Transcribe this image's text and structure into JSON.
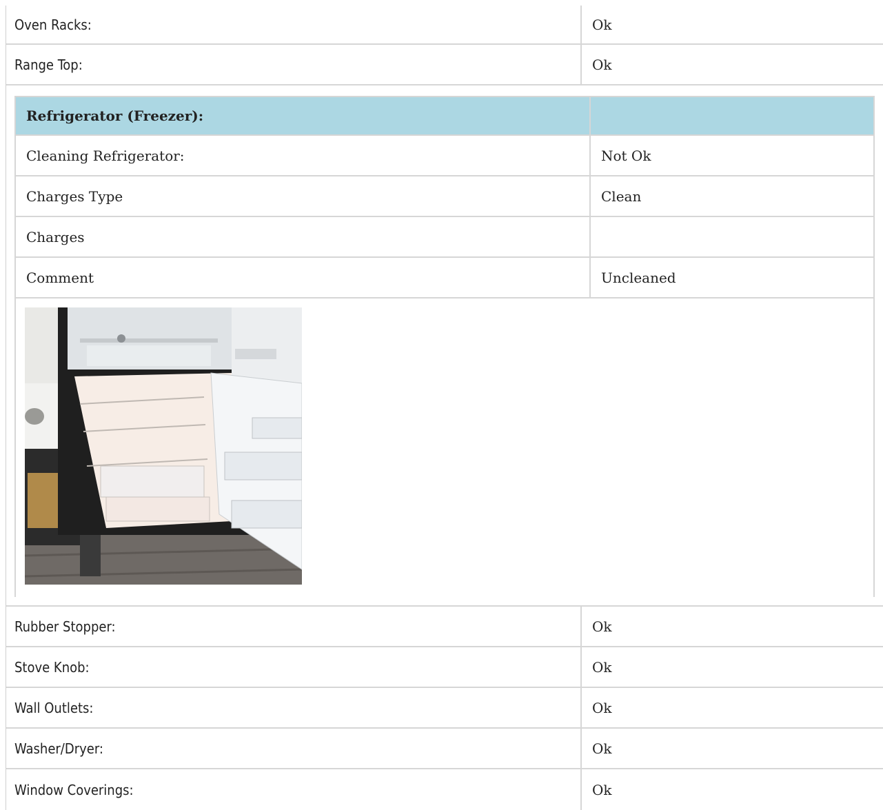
{
  "rows_top": [
    {
      "label": "Oven Racks:",
      "value": "Ok"
    },
    {
      "label": "Range Top:",
      "value": "Ok"
    }
  ],
  "section": {
    "title": "Refrigerator (Freezer):",
    "title_value": "",
    "rows": [
      {
        "label": "Cleaning Refrigerator:",
        "value": "Not Ok"
      },
      {
        "label": "Charges Type",
        "value": "Clean"
      },
      {
        "label": "Charges",
        "value": ""
      },
      {
        "label": "Comment",
        "value": "Uncleaned"
      }
    ],
    "photo_alt": "refrigerator-photo"
  },
  "rows_bottom": [
    {
      "label": "Rubber Stopper:",
      "value": "Ok"
    },
    {
      "label": "Stove Knob:",
      "value": "Ok"
    },
    {
      "label": "Wall Outlets:",
      "value": "Ok"
    },
    {
      "label": "Washer/Dryer:",
      "value": "Ok"
    },
    {
      "label": "Window Coverings:",
      "value": "Ok"
    }
  ],
  "colors": {
    "header_bg": "#acd7e3",
    "border": "#d6d6d6"
  }
}
